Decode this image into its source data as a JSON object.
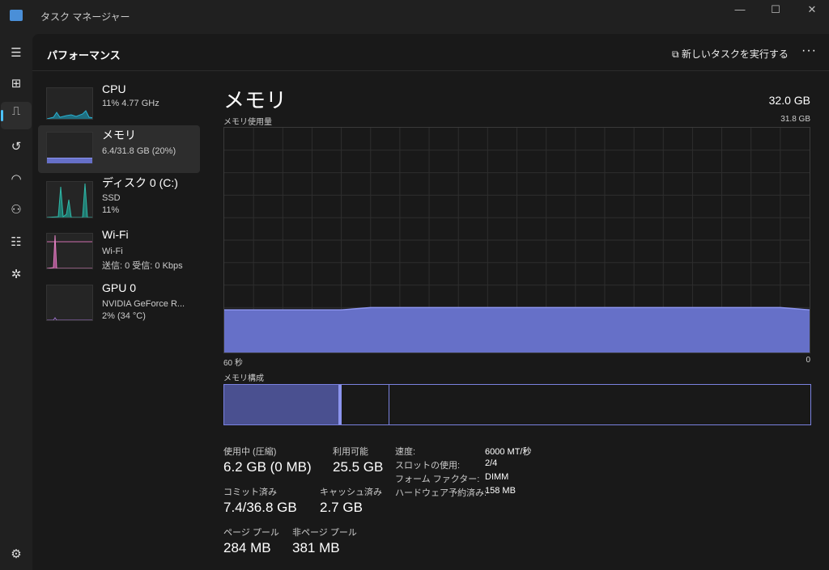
{
  "window": {
    "title": "タスク マネージャー",
    "minimize": "—",
    "maximize": "☐",
    "close": "✕"
  },
  "header": {
    "title": "パフォーマンス",
    "run_task": "新しいタスクを実行する",
    "more": "···"
  },
  "sidebar": [
    {
      "name": "CPU",
      "sub1": "11%  4.77 GHz"
    },
    {
      "name": "メモリ",
      "sub1": "6.4/31.8 GB (20%)"
    },
    {
      "name": "ディスク 0 (C:)",
      "sub1": "SSD",
      "sub2": "11%"
    },
    {
      "name": "Wi-Fi",
      "sub1": "Wi-Fi",
      "sub2": "送信: 0 受信: 0 Kbps"
    },
    {
      "name": "GPU 0",
      "sub1": "NVIDIA GeForce R...",
      "sub2": "2%  (34 °C)"
    }
  ],
  "memory": {
    "title": "メモリ",
    "total": "32.0 GB",
    "usage_label": "メモリ使用量",
    "usage_max": "31.8 GB",
    "time_left": "60 秒",
    "time_right": "0",
    "composition_label": "メモリ構成",
    "usage_history_fraction": [
      0.19,
      0.19,
      0.19,
      0.19,
      0.19,
      0.2,
      0.2,
      0.2,
      0.2,
      0.2,
      0.2,
      0.2,
      0.2,
      0.2,
      0.2,
      0.2,
      0.2,
      0.2,
      0.2,
      0.2,
      0.19
    ],
    "colors": {
      "fill": "#6670c8",
      "line": "#8c94ee"
    },
    "stats": [
      {
        "label": "使用中 (圧縮)",
        "value": "6.2 GB (0 MB)"
      },
      {
        "label": "利用可能",
        "value": "25.5 GB"
      },
      {
        "label": "コミット済み",
        "value": "7.4/36.8 GB"
      },
      {
        "label": "キャッシュ済み",
        "value": "2.7 GB"
      },
      {
        "label": "ページ プール",
        "value": "284 MB"
      },
      {
        "label": "非ページ プール",
        "value": "381 MB"
      }
    ],
    "details": [
      {
        "label": "速度:",
        "value": "6000 MT/秒"
      },
      {
        "label": "スロットの使用:",
        "value": "2/4"
      },
      {
        "label": "フォーム ファクター:",
        "value": "DIMM"
      },
      {
        "label": "ハードウェア予約済み:",
        "value": "158 MB"
      }
    ]
  }
}
